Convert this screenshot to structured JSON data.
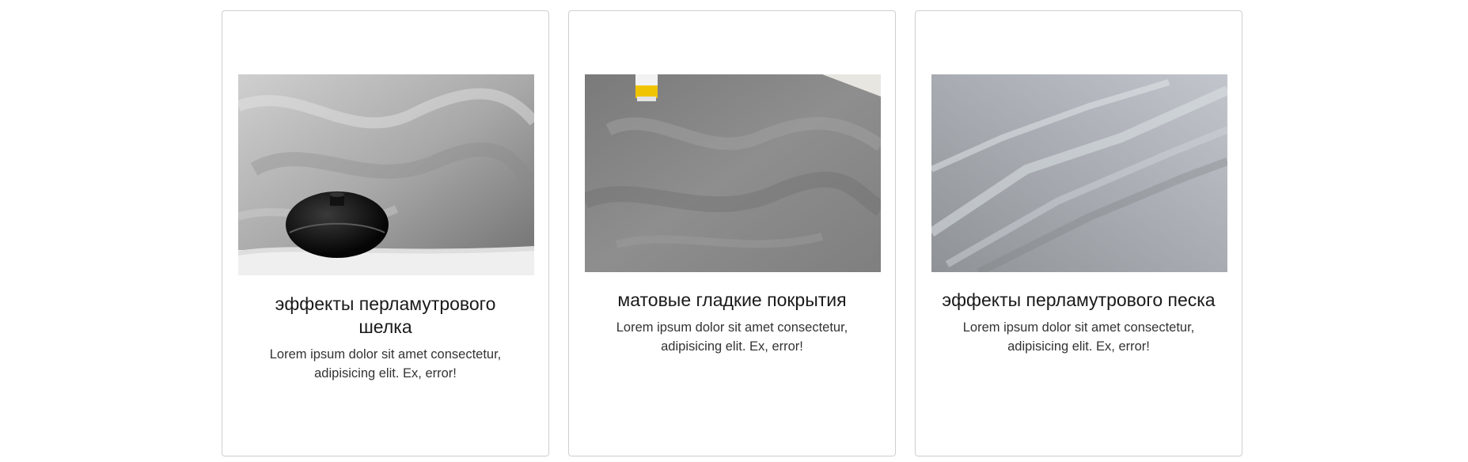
{
  "cards": [
    {
      "image_name": "pearl-silk-vase-image",
      "title": "эффекты перламутрового шелка",
      "text": "Lorem ipsum dolor sit amet consectetur, adipisicing elit. Ex, error!"
    },
    {
      "image_name": "matte-smooth-wall-image",
      "title": "матовые гладкие покрытия",
      "text": "Lorem ipsum dolor sit amet consectetur, adipisicing elit. Ex, error!"
    },
    {
      "image_name": "pearl-sand-wall-image",
      "title": "эффекты перламутрового песка",
      "text": "Lorem ipsum dolor sit amet consectetur, adipisicing elit. Ex, error!"
    }
  ],
  "colors": {
    "card_border": "#cfcfcf",
    "title_text": "#1a1a1a",
    "body_text": "#333333"
  }
}
